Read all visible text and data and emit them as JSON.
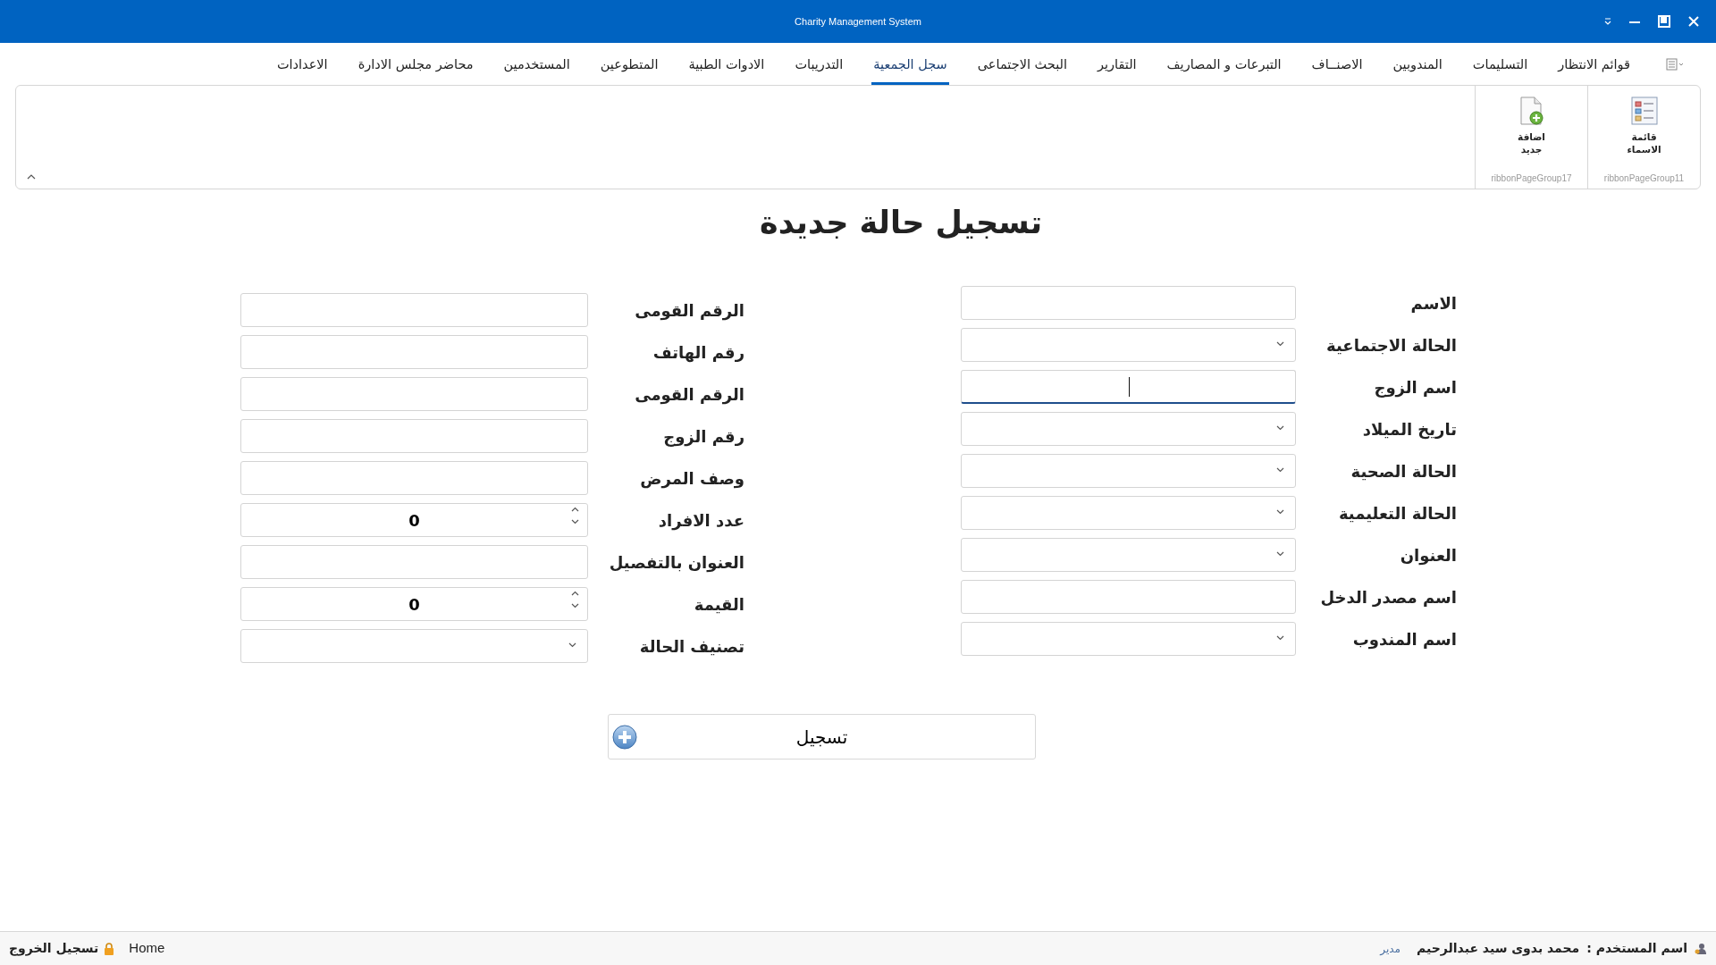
{
  "window": {
    "title": "Charity Management System"
  },
  "ribbon": {
    "tabs": [
      {
        "label": "قوائم الانتظار",
        "selected": false
      },
      {
        "label": "التسليمات",
        "selected": false
      },
      {
        "label": "المندوبين",
        "selected": false
      },
      {
        "label": "الاصنــاف",
        "selected": false
      },
      {
        "label": "التبرعات و المصاريف",
        "selected": false
      },
      {
        "label": "التقارير",
        "selected": false
      },
      {
        "label": "البحث الاجتماعى",
        "selected": false
      },
      {
        "label": "سجل الجمعية",
        "selected": true
      },
      {
        "label": "التدريبات",
        "selected": false
      },
      {
        "label": "الادوات الطبية",
        "selected": false
      },
      {
        "label": "المتطوعين",
        "selected": false
      },
      {
        "label": "المستخدمين",
        "selected": false
      },
      {
        "label": "محاضر مجلس الادارة",
        "selected": false
      },
      {
        "label": "الاعدادات",
        "selected": false
      }
    ],
    "groups": [
      {
        "kind": "list",
        "button": "قائمة الاسماء",
        "caption": "ribbonPageGroup11"
      },
      {
        "kind": "add",
        "button": "اضافة جديد",
        "caption": "ribbonPageGroup17"
      }
    ]
  },
  "form": {
    "title": "تسجيل حالة جديدة",
    "right_fields": [
      {
        "label": "الاسم",
        "kind": "text",
        "focused": false
      },
      {
        "label": "الحالة الاجتماعية",
        "kind": "dropdown",
        "focused": false
      },
      {
        "label": "اسم الزوج",
        "kind": "text",
        "focused": true
      },
      {
        "label": "تاريخ الميلاد",
        "kind": "dropdown",
        "focused": false
      },
      {
        "label": "الحالة الصحية",
        "kind": "dropdown",
        "focused": false
      },
      {
        "label": "الحالة التعليمية",
        "kind": "dropdown",
        "focused": false
      },
      {
        "label": "العنوان",
        "kind": "dropdown",
        "focused": false
      },
      {
        "label": "اسم مصدر الدخل",
        "kind": "text",
        "focused": false
      },
      {
        "label": "اسم المندوب",
        "kind": "dropdown",
        "focused": false
      }
    ],
    "left_fields": [
      {
        "label": "الرقم القومى",
        "kind": "text",
        "focused": false
      },
      {
        "label": "رقم الهاتف",
        "kind": "text",
        "focused": false
      },
      {
        "label": "الرقم القومى",
        "kind": "text",
        "focused": false
      },
      {
        "label": "رقم الزوج",
        "kind": "text",
        "focused": false
      },
      {
        "label": "وصف المرض",
        "kind": "text",
        "focused": false
      },
      {
        "label": "عدد الافراد",
        "kind": "spin",
        "value": "0",
        "focused": false
      },
      {
        "label": "العنوان بالتفصيل",
        "kind": "text",
        "focused": false
      },
      {
        "label": "القيمة",
        "kind": "spin",
        "value": "0",
        "focused": false
      },
      {
        "label": "تصنيف الحالة",
        "kind": "dropdown",
        "focused": false
      }
    ],
    "submit": "تسجيل"
  },
  "status_bar": {
    "user_label": "اسم المستخدم :",
    "user_name": "محمد بدوى سيد عبدالرحيم",
    "role": "مدير",
    "home": "Home",
    "logout": "تسجيل الخروج"
  }
}
